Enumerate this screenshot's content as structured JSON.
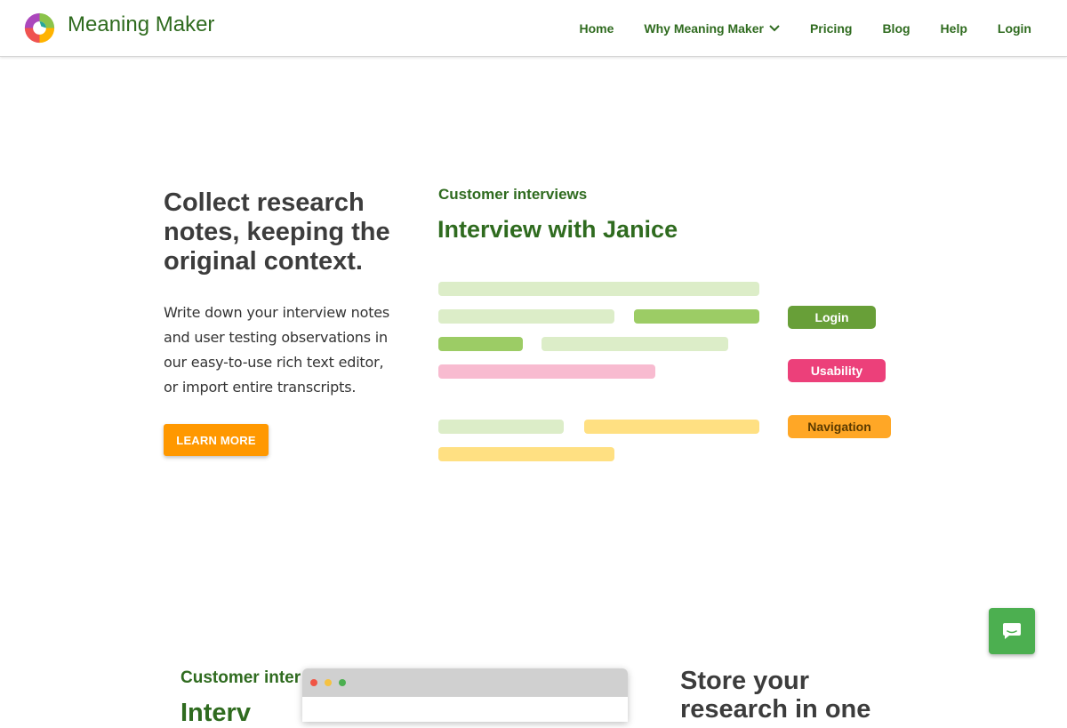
{
  "header": {
    "brand": "Meaning Maker",
    "nav": [
      {
        "label": "Home"
      },
      {
        "label": "Why Meaning Maker",
        "has_dropdown": true
      },
      {
        "label": "Pricing"
      },
      {
        "label": "Blog"
      },
      {
        "label": "Help"
      },
      {
        "label": "Login"
      }
    ]
  },
  "hero": {
    "title": "Collect research notes, keeping the original context.",
    "body": "Write down your interview notes and user testing observations in our easy-to-use rich text editor, or import entire transcripts.",
    "cta_label": "LEARN MORE",
    "illustration": {
      "section_label": "Customer interviews",
      "title": "Interview with Janice",
      "tags": [
        {
          "label": "Login",
          "color": "#689f38"
        },
        {
          "label": "Usability",
          "color": "#ec407a"
        },
        {
          "label": "Navigation",
          "color": "#ffa726"
        }
      ]
    }
  },
  "bottom": {
    "section_label": "Customer inter",
    "heading_partial": "Interv",
    "store_heading": "Store your research in one"
  },
  "colors": {
    "brand_green": "#2f6b1f",
    "cta_orange": "#ff9800",
    "chat_green": "#4caf50"
  },
  "icons": {
    "logo": "meaning-maker-logo",
    "chat": "chat-bubble-icon",
    "dropdown": "chevron-down-icon"
  }
}
